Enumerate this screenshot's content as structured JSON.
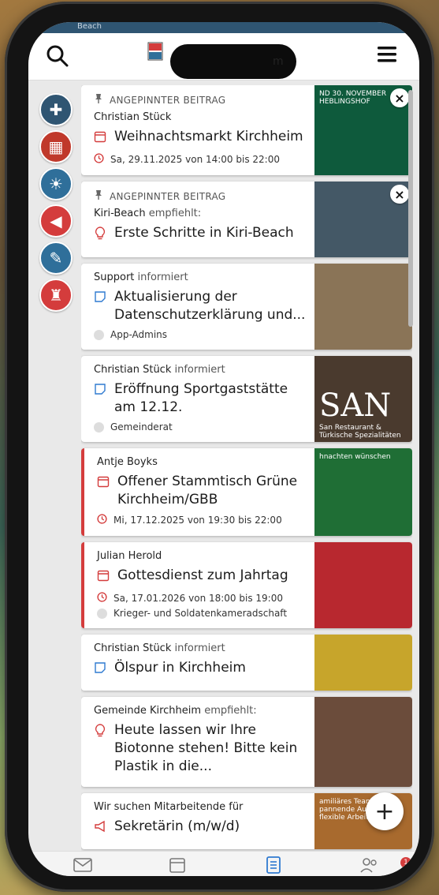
{
  "statusbar": {
    "text": "Beach"
  },
  "header": {
    "title_fragment": "m"
  },
  "sidebar": {
    "items": [
      {
        "icon": "gift-icon",
        "color": "#2f5572"
      },
      {
        "icon": "calendar-icon",
        "color": "#c0392b"
      },
      {
        "icon": "lightbulb-icon",
        "color": "#2f6f9a"
      },
      {
        "icon": "megaphone-icon",
        "color": "#d43c3c"
      },
      {
        "icon": "note-icon",
        "color": "#2f6f9a"
      },
      {
        "icon": "crest-icon",
        "color": "#d43c3c"
      }
    ]
  },
  "feed": [
    {
      "pinned_label": "ANGEPINNTER BEITRAG",
      "author": "Christian Stück",
      "verb": "",
      "title": "Weihnachtsmarkt Kirchheim",
      "type": "event",
      "date": "Sa, 29.11.2025 von 14:00 bis 22:00",
      "thumb_text": "ND 30. NOVEMBER\nHEBLINGSHOF",
      "thumb_color": "#0e5a3c",
      "closable": true
    },
    {
      "pinned_label": "ANGEPINNTER BEITRAG",
      "author": "Kiri-Beach",
      "verb": "empfiehlt:",
      "title": "Erste Schritte in Kiri-Beach",
      "type": "tip",
      "thumb_color": "#445866",
      "closable": true
    },
    {
      "author": "Support",
      "verb": "informiert",
      "title": "Aktualisierung der Datenschutzerklärung und...",
      "type": "note",
      "group": "App-Admins",
      "thumb_color": "#8a7457"
    },
    {
      "author": "Christian Stück",
      "verb": "informiert",
      "title": "Eröffnung Sportgaststätte am 12.12.",
      "type": "note",
      "group": "Gemeinderat",
      "thumb_text": "SAN",
      "thumb_sub": "San Restaurant &\nTürkische Spezialitäten",
      "thumb_color": "#4a3a2e"
    },
    {
      "author": "Antje Boyks",
      "verb": "",
      "title": "Offener Stammtisch Grüne Kirchheim/GBB",
      "type": "event",
      "date": "Mi, 17.12.2025 von 19:30 bis 22:00",
      "thumb_text": "hnachten wünschen",
      "thumb_color": "#1f6e35",
      "accent": true
    },
    {
      "author": "Julian Herold",
      "verb": "",
      "title": "Gottesdienst zum Jahrtag",
      "type": "event",
      "date": "Sa, 17.01.2026 von 18:00 bis 19:00",
      "group": "Krieger- und Soldatenkameradschaft",
      "thumb_color": "#b8282f",
      "accent": true
    },
    {
      "author": "Christian Stück",
      "verb": "informiert",
      "title": "Ölspur in Kirchheim",
      "type": "note",
      "thumb_color": "#c7a52b"
    },
    {
      "author": "Gemeinde Kirchheim",
      "verb": "empfiehlt:",
      "title": "Heute lassen wir Ihre Biotonne stehen! Bitte kein Plastik in die...",
      "type": "tip",
      "thumb_color": "#6b4c3b"
    },
    {
      "author": "Wir suchen Mitarbeitende für",
      "verb": "",
      "title": "Sekretärin (m/w/d)",
      "type": "job",
      "thumb_text": "amiliäres Team,\npannende Aufgaben,\nflexible Arbeitszeiten,",
      "thumb_color": "#a86a2e"
    }
  ],
  "bottom_nav": {
    "items": [
      "mail-icon",
      "calendar-icon",
      "feed-icon",
      "people-icon"
    ],
    "active": "feed-icon",
    "badge": "1"
  },
  "fab_label": "+"
}
